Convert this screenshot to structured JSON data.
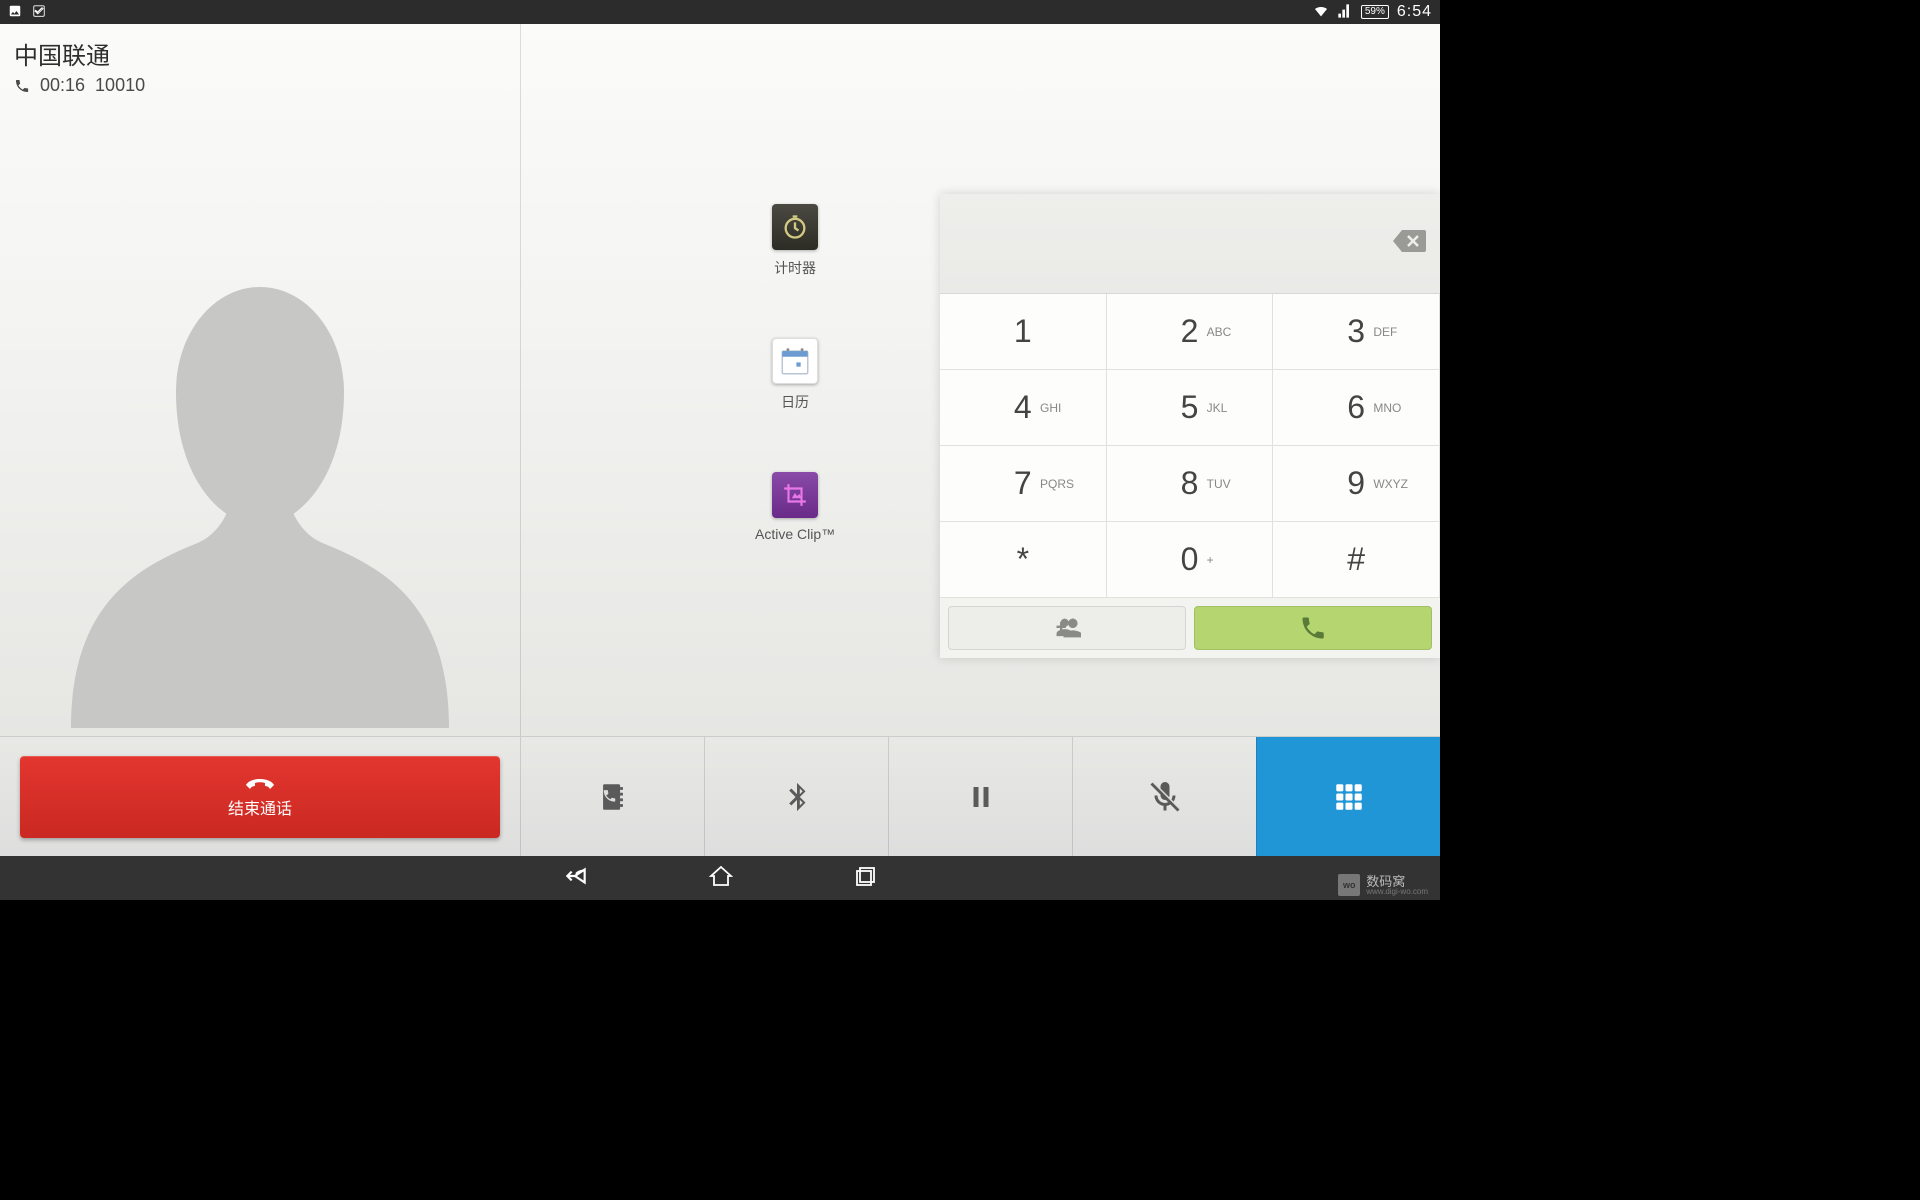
{
  "statusbar": {
    "battery": "59%",
    "time": "6:54"
  },
  "call": {
    "carrier": "中国联通",
    "duration": "00:16",
    "number": "10010",
    "end_label": "结束通话"
  },
  "apps": [
    {
      "id": "timer",
      "label": "计时器"
    },
    {
      "id": "calendar",
      "label": "日历"
    },
    {
      "id": "activeclip",
      "label": "Active Clip™"
    }
  ],
  "dialpad": {
    "keys": [
      {
        "digit": "1",
        "letters": ""
      },
      {
        "digit": "2",
        "letters": "ABC"
      },
      {
        "digit": "3",
        "letters": "DEF"
      },
      {
        "digit": "4",
        "letters": "GHI"
      },
      {
        "digit": "5",
        "letters": "JKL"
      },
      {
        "digit": "6",
        "letters": "MNO"
      },
      {
        "digit": "7",
        "letters": "PQRS"
      },
      {
        "digit": "8",
        "letters": "TUV"
      },
      {
        "digit": "9",
        "letters": "WXYZ"
      },
      {
        "digit": "*",
        "letters": ""
      },
      {
        "digit": "0",
        "letters": "+"
      },
      {
        "digit": "#",
        "letters": ""
      }
    ]
  },
  "watermark": {
    "logo": "wo",
    "title": "数码窝",
    "url": "www.digi-wo.com"
  }
}
